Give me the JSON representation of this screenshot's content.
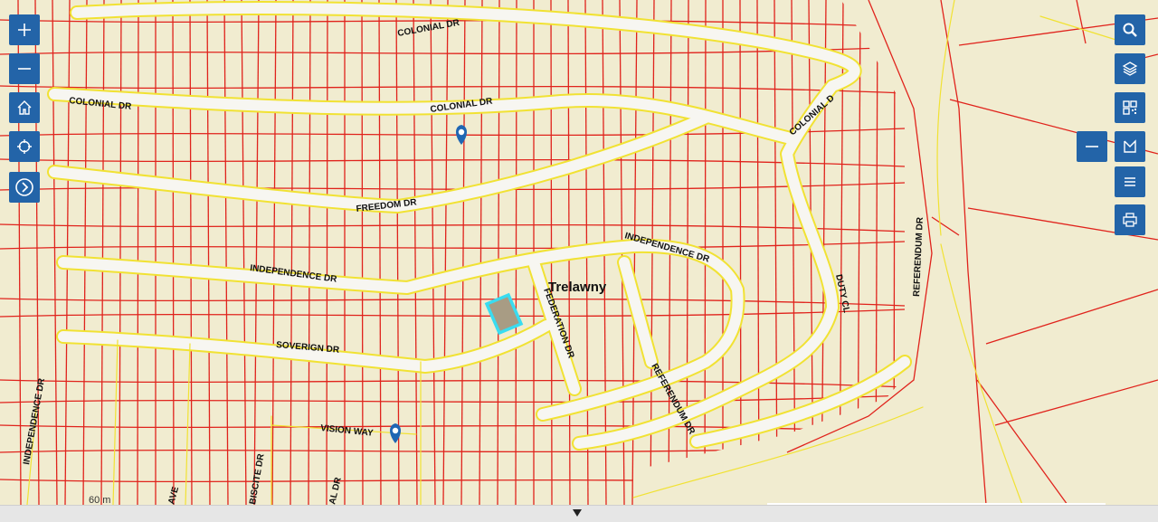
{
  "map": {
    "place_name": "Trelawny",
    "scale_text": "60 m",
    "street_labels": {
      "colonial_top": "COLONIAL DR",
      "colonial_left": "COLONIAL DR",
      "colonial_mid": "COLONIAL DR",
      "colonial_right": "COLONIAL DR",
      "freedom": "FREEDOM  DR",
      "independence_right": "INDEPENDENCE DR",
      "independence_mid": "INDEPENDENCE DR",
      "independence_left": "INDEPENDENCE DR",
      "soverign": "SOVERIGN DR",
      "federation": "FEDERATION DR",
      "referendum_mid": "REFERENDUM DR",
      "referendum_right": "REFERENDUM DR",
      "duty": "DUTY CL",
      "vision": "VISION WAY",
      "ave": "AVE",
      "biscite": "BISCITE DR",
      "al_dr": "AL DR"
    },
    "colors": {
      "land": "#f1ecd0",
      "parcel_line": "#e0231c",
      "road_fill": "#f7f6f1",
      "road_edge": "#f1e233",
      "toolbar_button": "#2364a8",
      "selected_parcel_outline": "#39dcf0",
      "selected_parcel_fill": "#a89c84",
      "marker": "#1f66b3"
    }
  },
  "toolbar_left": [
    {
      "name": "zoom-in",
      "icon": "plus-icon"
    },
    {
      "name": "zoom-out",
      "icon": "minus-icon"
    },
    {
      "name": "home",
      "icon": "home-icon"
    },
    {
      "name": "locate",
      "icon": "crosshair-icon"
    },
    {
      "name": "expand",
      "icon": "chevron-right-icon"
    }
  ],
  "toolbar_right": [
    {
      "name": "search",
      "icon": "search-icon"
    },
    {
      "name": "layers",
      "icon": "layers-icon"
    },
    {
      "name": "qr",
      "icon": "qr-icon"
    },
    {
      "name": "measure",
      "icon": "measure-icon"
    },
    {
      "name": "legend",
      "icon": "list-icon"
    },
    {
      "name": "print",
      "icon": "print-icon"
    }
  ]
}
